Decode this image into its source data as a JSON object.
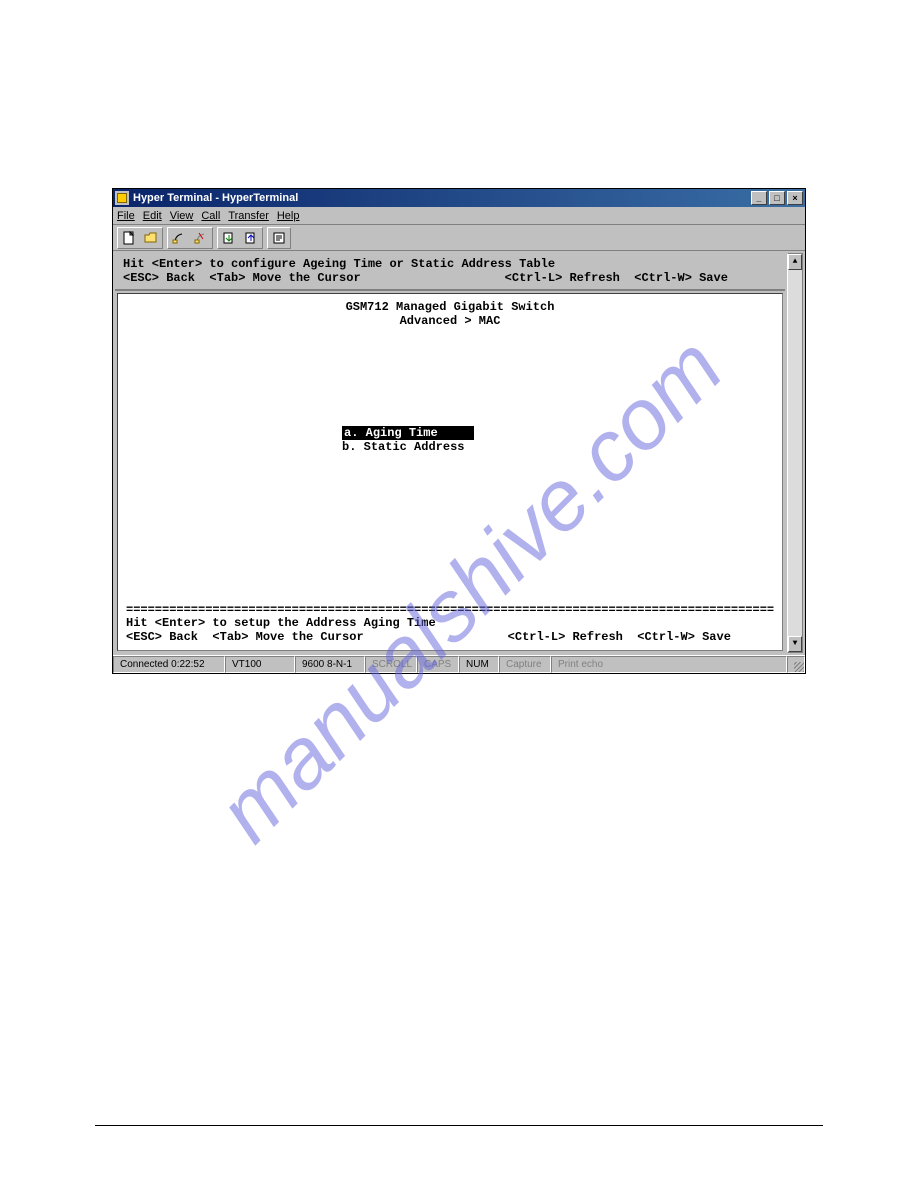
{
  "titlebar": {
    "text": "Hyper Terminal - HyperTerminal"
  },
  "window_buttons": {
    "minimize": "_",
    "maximize": "□",
    "close": "×"
  },
  "menubar": {
    "file": "File",
    "edit": "Edit",
    "view": "View",
    "call": "Call",
    "transfer": "Transfer",
    "help": "Help"
  },
  "toolbar_icons": {
    "new": "new-doc-icon",
    "open": "open-folder-icon",
    "connect": "connect-icon",
    "disconnect": "disconnect-icon",
    "send": "send-icon",
    "receive": "receive-icon",
    "properties": "properties-icon"
  },
  "terminal": {
    "top_line1": "Hit <Enter> to configure Ageing Time or Static Address Table",
    "top_line2": "<ESC> Back  <Tab> Move the Cursor                    <Ctrl-L> Refresh  <Ctrl-W> Save",
    "header_line1": "GSM712 Managed Gigabit Switch",
    "header_line2": "Advanced > MAC",
    "menu_a_full": "a. Aging Time",
    "menu_b": "b. Static Address",
    "foot_line1": "Hit <Enter> to setup the Address Aging Time",
    "foot_line2": "<ESC> Back  <Tab> Move the Cursor                    <Ctrl-L> Refresh  <Ctrl-W> Save"
  },
  "statusbar": {
    "connected": "Connected 0:22:52",
    "emulation": "VT100",
    "settings": "9600 8-N-1",
    "scroll": "SCROLL",
    "caps": "CAPS",
    "num": "NUM",
    "capture": "Capture",
    "printecho": "Print echo"
  },
  "watermark": "manualshive.com",
  "footer": {
    "left": " ",
    "right": " "
  }
}
